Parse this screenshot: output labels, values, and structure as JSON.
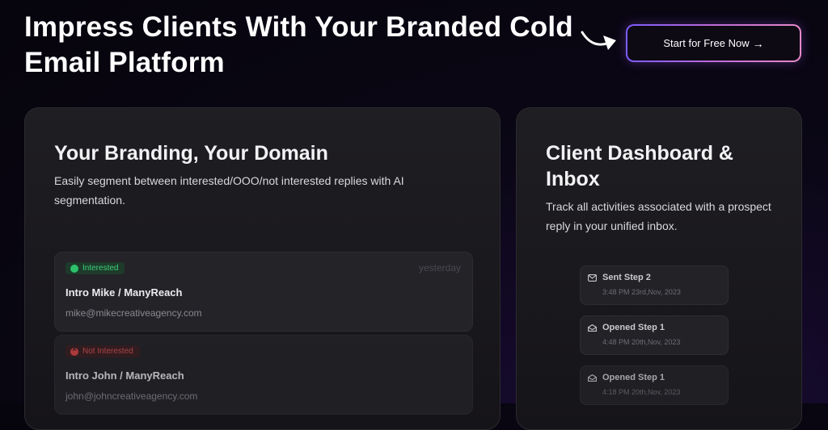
{
  "hero": {
    "title": "Impress Clients With Your Branded Cold Email Platform",
    "cta_label": "Start for Free Now",
    "cta_icon": "arrow-right-icon"
  },
  "branding_card": {
    "title": "Your Branding, Your Domain",
    "description": "Easily segment between interested/OOO/not interested replies with AI segmentation.",
    "emails": [
      {
        "badge": "Interested",
        "badge_color": "#2dc26b",
        "time": "yesterday",
        "subject": "Intro Mike / ManyReach",
        "address": "mike@mikecreativeagency.com"
      },
      {
        "badge": "Not Interested",
        "badge_color": "#e04848",
        "subject": "Intro John / ManyReach",
        "address": "john@johncreativeagency.com"
      }
    ]
  },
  "dashboard_card": {
    "title": "Client Dashboard & Inbox",
    "description": "Track all activities associated with a prospect reply in your unified inbox.",
    "activities": [
      {
        "icon": "mail-icon",
        "title": "Sent Step 2",
        "time": "3:48 PM 23rd,Nov, 2023"
      },
      {
        "icon": "mail-open-icon",
        "title": "Opened Step 1",
        "time": "4:48 PM 20th,Nov, 2023"
      },
      {
        "icon": "mail-open-icon",
        "title": "Opened Step 1",
        "time": "4:18 PM 20th,Nov, 2023"
      }
    ]
  },
  "colors": {
    "accent_gradient_start": "#7c5cff",
    "accent_gradient_end": "#e88ac8",
    "background": "#0b0716"
  }
}
